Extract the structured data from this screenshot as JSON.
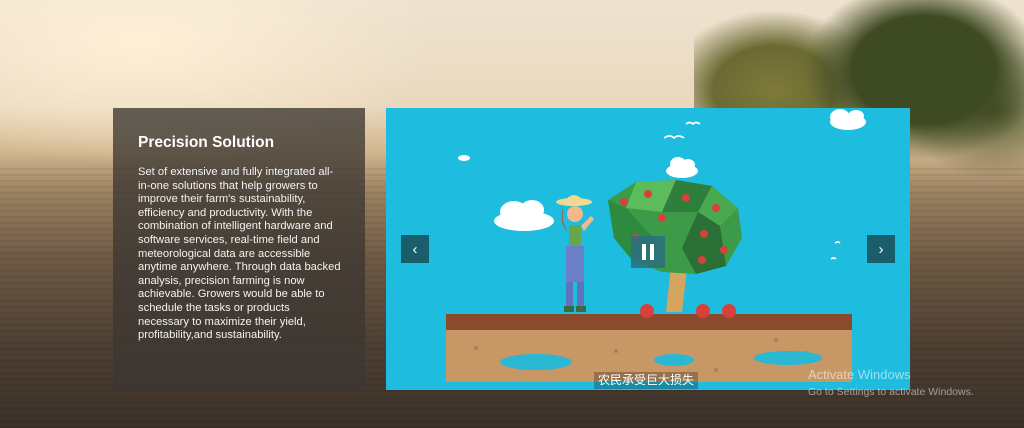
{
  "panel": {
    "title": "Precision Solution",
    "body": "Set of extensive and fully integrated all-in-one solutions that help growers to improve their farm's sustainability, efficiency and productivity. With the combination of intelligent hardware and software services, real-time field and meteorological data are accessible anytime anywhere. Through data backed analysis, precision farming is now achievable. Growers would be able to schedule the tasks or products necessary to maximize their yield, profitability,and sustainability."
  },
  "video": {
    "subtitle": "农民承受巨大损失",
    "background_color": "#1ebde0"
  },
  "carousel": {
    "prev_icon": "chevron-left-icon",
    "next_icon": "chevron-right-icon",
    "prev_glyph": "‹",
    "next_glyph": "›"
  },
  "watermark": {
    "line1": "Activate Windows",
    "line2": "Go to Settings to activate Windows."
  }
}
